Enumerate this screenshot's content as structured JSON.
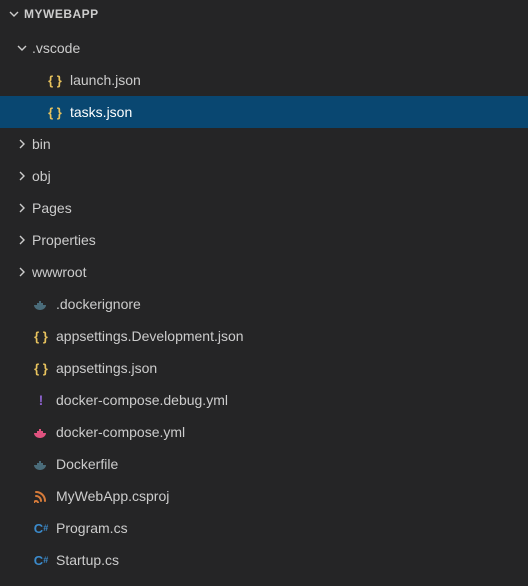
{
  "header": {
    "title": "MYWEBAPP"
  },
  "tree": {
    "vscode_folder": ".vscode",
    "launch_json": "launch.json",
    "tasks_json": "tasks.json",
    "bin": "bin",
    "obj": "obj",
    "pages": "Pages",
    "properties": "Properties",
    "wwwroot": "wwwroot",
    "dockerignore": ".dockerignore",
    "appsettings_dev": "appsettings.Development.json",
    "appsettings": "appsettings.json",
    "compose_debug": "docker-compose.debug.yml",
    "compose": "docker-compose.yml",
    "dockerfile": "Dockerfile",
    "csproj": "MyWebApp.csproj",
    "program": "Program.cs",
    "startup": "Startup.cs"
  }
}
